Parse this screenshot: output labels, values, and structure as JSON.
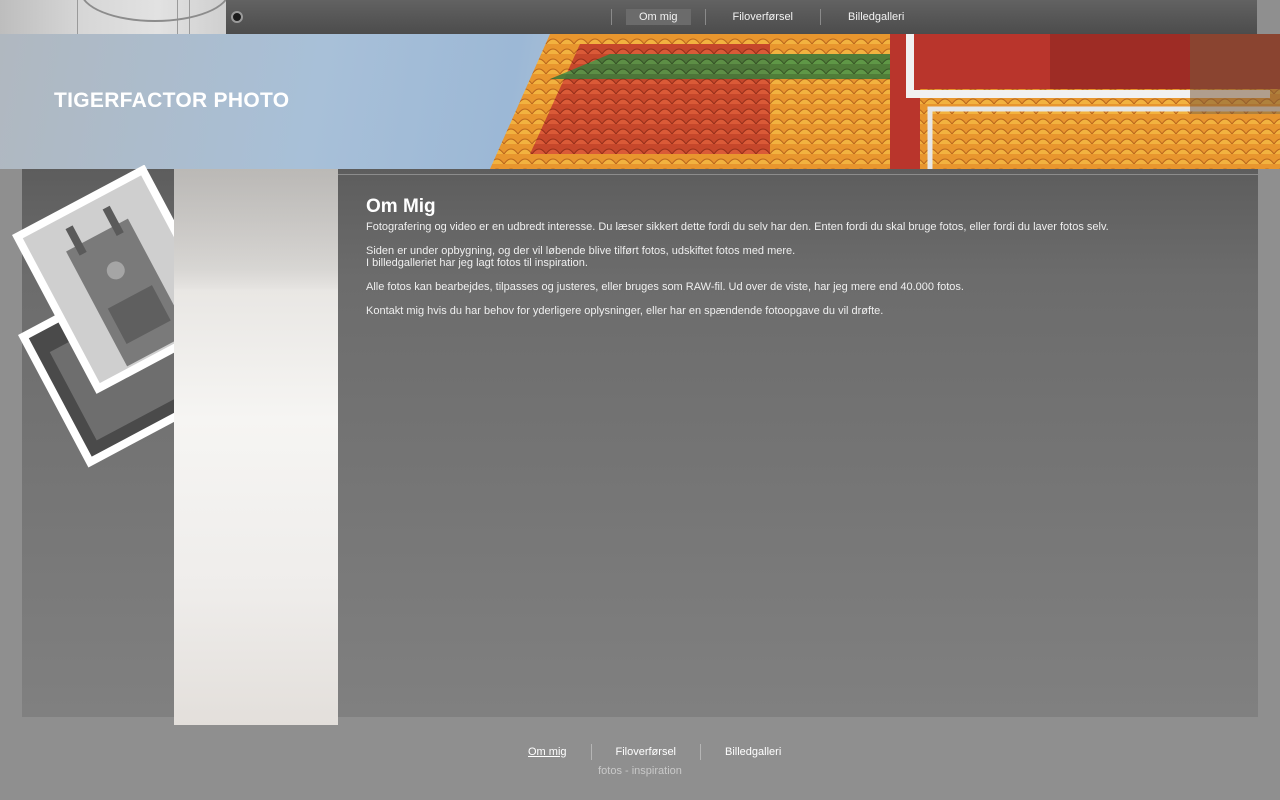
{
  "site": {
    "title": "TIGERFACTOR PHOTO"
  },
  "nav": {
    "items": [
      {
        "label": "Om mig",
        "active": true
      },
      {
        "label": "Filoverførsel",
        "active": false
      },
      {
        "label": "Billedgalleri",
        "active": false
      }
    ]
  },
  "main": {
    "heading": "Om Mig",
    "paragraphs": [
      "Fotografering og video er en udbredt interesse. Du læser sikkert dette fordi du selv har den. Enten fordi du skal bruge fotos, eller fordi du laver fotos selv.",
      "Siden er under opbygning, og der vil løbende blive tilført fotos, udskiftet fotos med mere.",
      "I billedgalleriet har jeg lagt fotos til inspiration.",
      "Alle fotos kan bearbejdes, tilpasses og justeres, eller bruges som RAW-fil. Ud over de viste, har jeg mere end 40.000 fotos.",
      "Kontakt mig hvis du har behov for yderligere oplysninger, eller har en spændende fotoopgave du vil drøfte."
    ]
  },
  "footer": {
    "nav": [
      {
        "label": "Om mig",
        "active": true
      },
      {
        "label": "Filoverførsel",
        "active": false
      },
      {
        "label": "Billedgalleri",
        "active": false
      }
    ],
    "tagline": "fotos - inspiration"
  },
  "colors": {
    "page_bg": "#8f8f8f",
    "topbar": "#555555",
    "active_tab": "#6b6b6b",
    "text": "#f0f0f0"
  }
}
